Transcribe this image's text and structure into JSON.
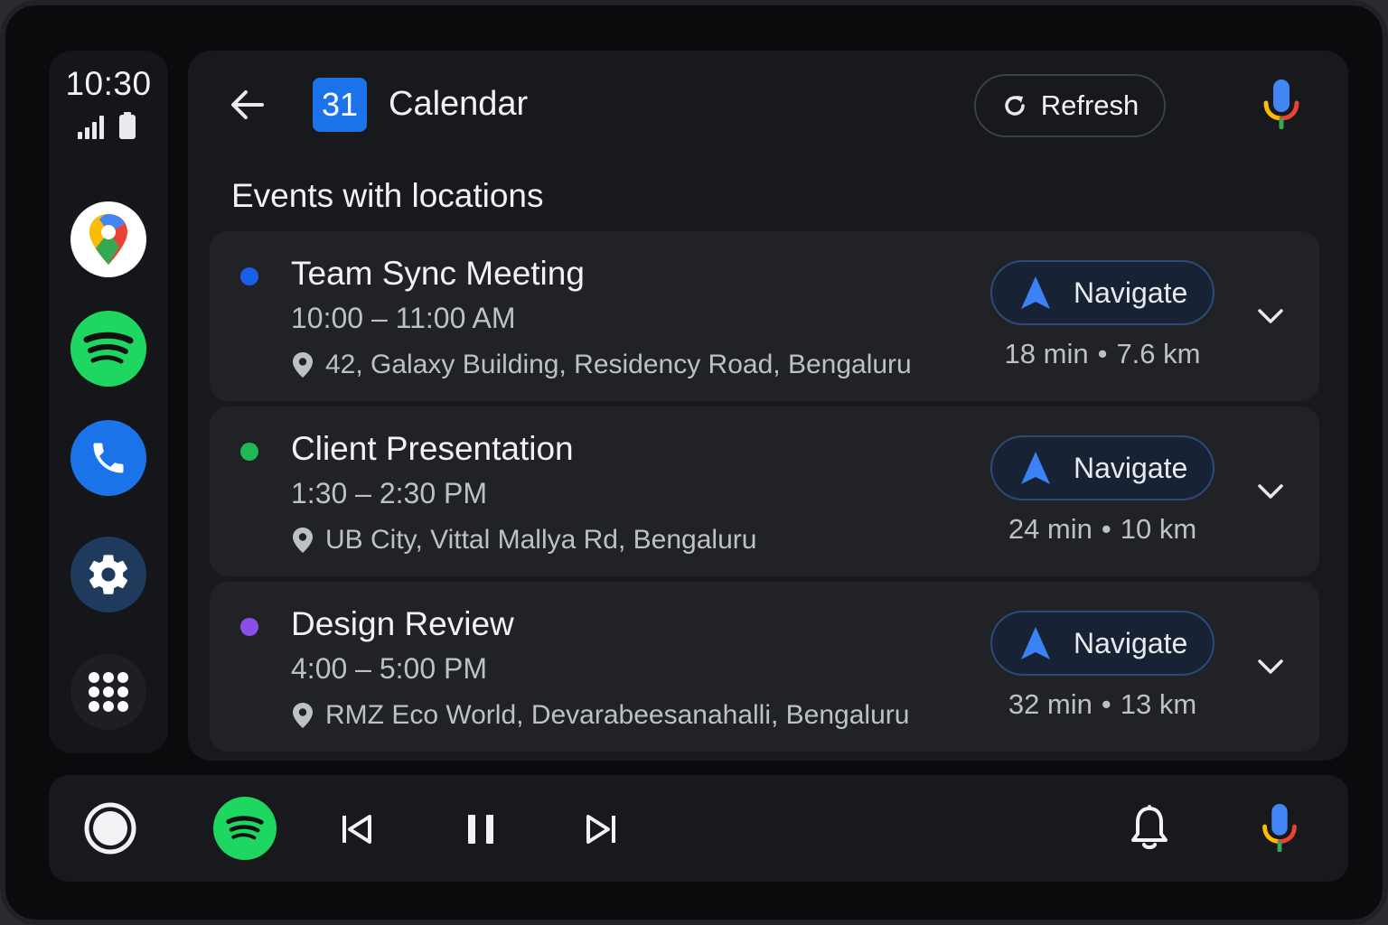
{
  "status": {
    "time": "10:30"
  },
  "rail": {
    "apps": [
      {
        "name": "maps",
        "icon": "google-maps-icon"
      },
      {
        "name": "spotify",
        "icon": "spotify-icon"
      },
      {
        "name": "phone",
        "icon": "phone-icon"
      },
      {
        "name": "settings",
        "icon": "gear-icon"
      },
      {
        "name": "launcher",
        "icon": "app-grid-icon"
      }
    ]
  },
  "header": {
    "calendar_badge": "31",
    "title": "Calendar",
    "refresh_label": "Refresh"
  },
  "section_title": "Events with locations",
  "events": [
    {
      "title": "Team Sync Meeting",
      "time": "10:00 – 11:00 AM",
      "address": "42, Galaxy Building, Residency Road, Bengaluru",
      "dot_color": "#1a5fe8",
      "navigate_label": "Navigate",
      "duration": "18 min",
      "distance": "7.6 km"
    },
    {
      "title": "Client Presentation",
      "time": "1:30 – 2:30 PM",
      "address": "UB City, Vittal Mallya Rd, Bengaluru",
      "dot_color": "#1fb954",
      "navigate_label": "Navigate",
      "duration": "24 min",
      "distance": "10 km"
    },
    {
      "title": "Design Review",
      "time": "4:00 – 5:00 PM",
      "address": "RMZ Eco World, Devarabeesanahalli, Bengaluru",
      "dot_color": "#8a4fe8",
      "navigate_label": "Navigate",
      "duration": "32 min",
      "distance": "13 km"
    }
  ],
  "colors": {
    "accent_blue": "#1a73e8",
    "spotify_green": "#1ed760",
    "background": "#0a0b0d"
  }
}
